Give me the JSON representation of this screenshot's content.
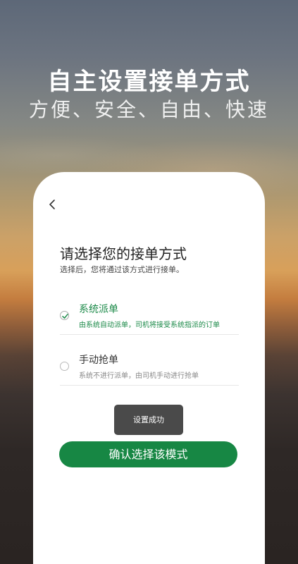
{
  "header": {
    "headline": "自主设置接单方式",
    "subheadline": "方便、安全、自由、快速"
  },
  "card": {
    "title": "请选择您的接单方式",
    "description": "选择后，您将通过该方式进行接单。",
    "options": [
      {
        "label": "系统派单",
        "description": "由系统自动派单，司机将接受系统指派的订单",
        "selected": true
      },
      {
        "label": "手动抢单",
        "description": "系统不进行派单，由司机手动进行抢单",
        "selected": false
      }
    ],
    "toast": "设置成功",
    "confirm_label": "确认选择该模式"
  },
  "colors": {
    "accent": "#178744",
    "selected_text": "#1c8a49",
    "toast_bg": "#4a4a4a"
  },
  "icons": {
    "back": "chevron-left-icon",
    "selected": "checkmark-icon"
  }
}
